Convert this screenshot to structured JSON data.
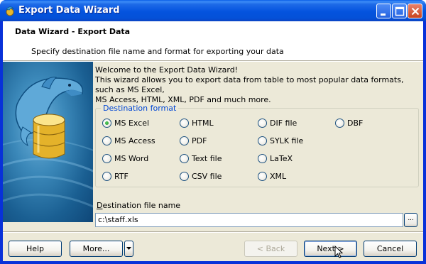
{
  "window": {
    "title": "Export Data Wizard"
  },
  "header": {
    "title": "Data Wizard - Export Data",
    "subtitle": "Specify destination file name and format for exporting your data"
  },
  "welcome": {
    "line1": "Welcome to the Export Data Wizard!",
    "line2": "This wizard allows you to export data from table to most popular data formats, such as MS Excel,",
    "line3": "MS Access, HTML, XML, PDF and much more."
  },
  "format": {
    "legend": "Destination format",
    "selected": "MS Excel",
    "options": [
      {
        "label": "MS Excel"
      },
      {
        "label": "HTML"
      },
      {
        "label": "DIF file"
      },
      {
        "label": "DBF"
      },
      {
        "label": "MS Access"
      },
      {
        "label": "PDF"
      },
      {
        "label": "SYLK file"
      },
      {
        "label": "MS Word"
      },
      {
        "label": "Text file"
      },
      {
        "label": "LaTeX"
      },
      {
        "label": "RTF"
      },
      {
        "label": "CSV file"
      },
      {
        "label": "XML"
      }
    ]
  },
  "destination": {
    "label_prefix": "D",
    "label_rest": "estination file name",
    "value": "c:\\staff.xls",
    "browse_label": "..."
  },
  "buttons": {
    "help": "Help",
    "more": "More...",
    "back": "< Back",
    "next": "Next >",
    "cancel": "Cancel"
  }
}
